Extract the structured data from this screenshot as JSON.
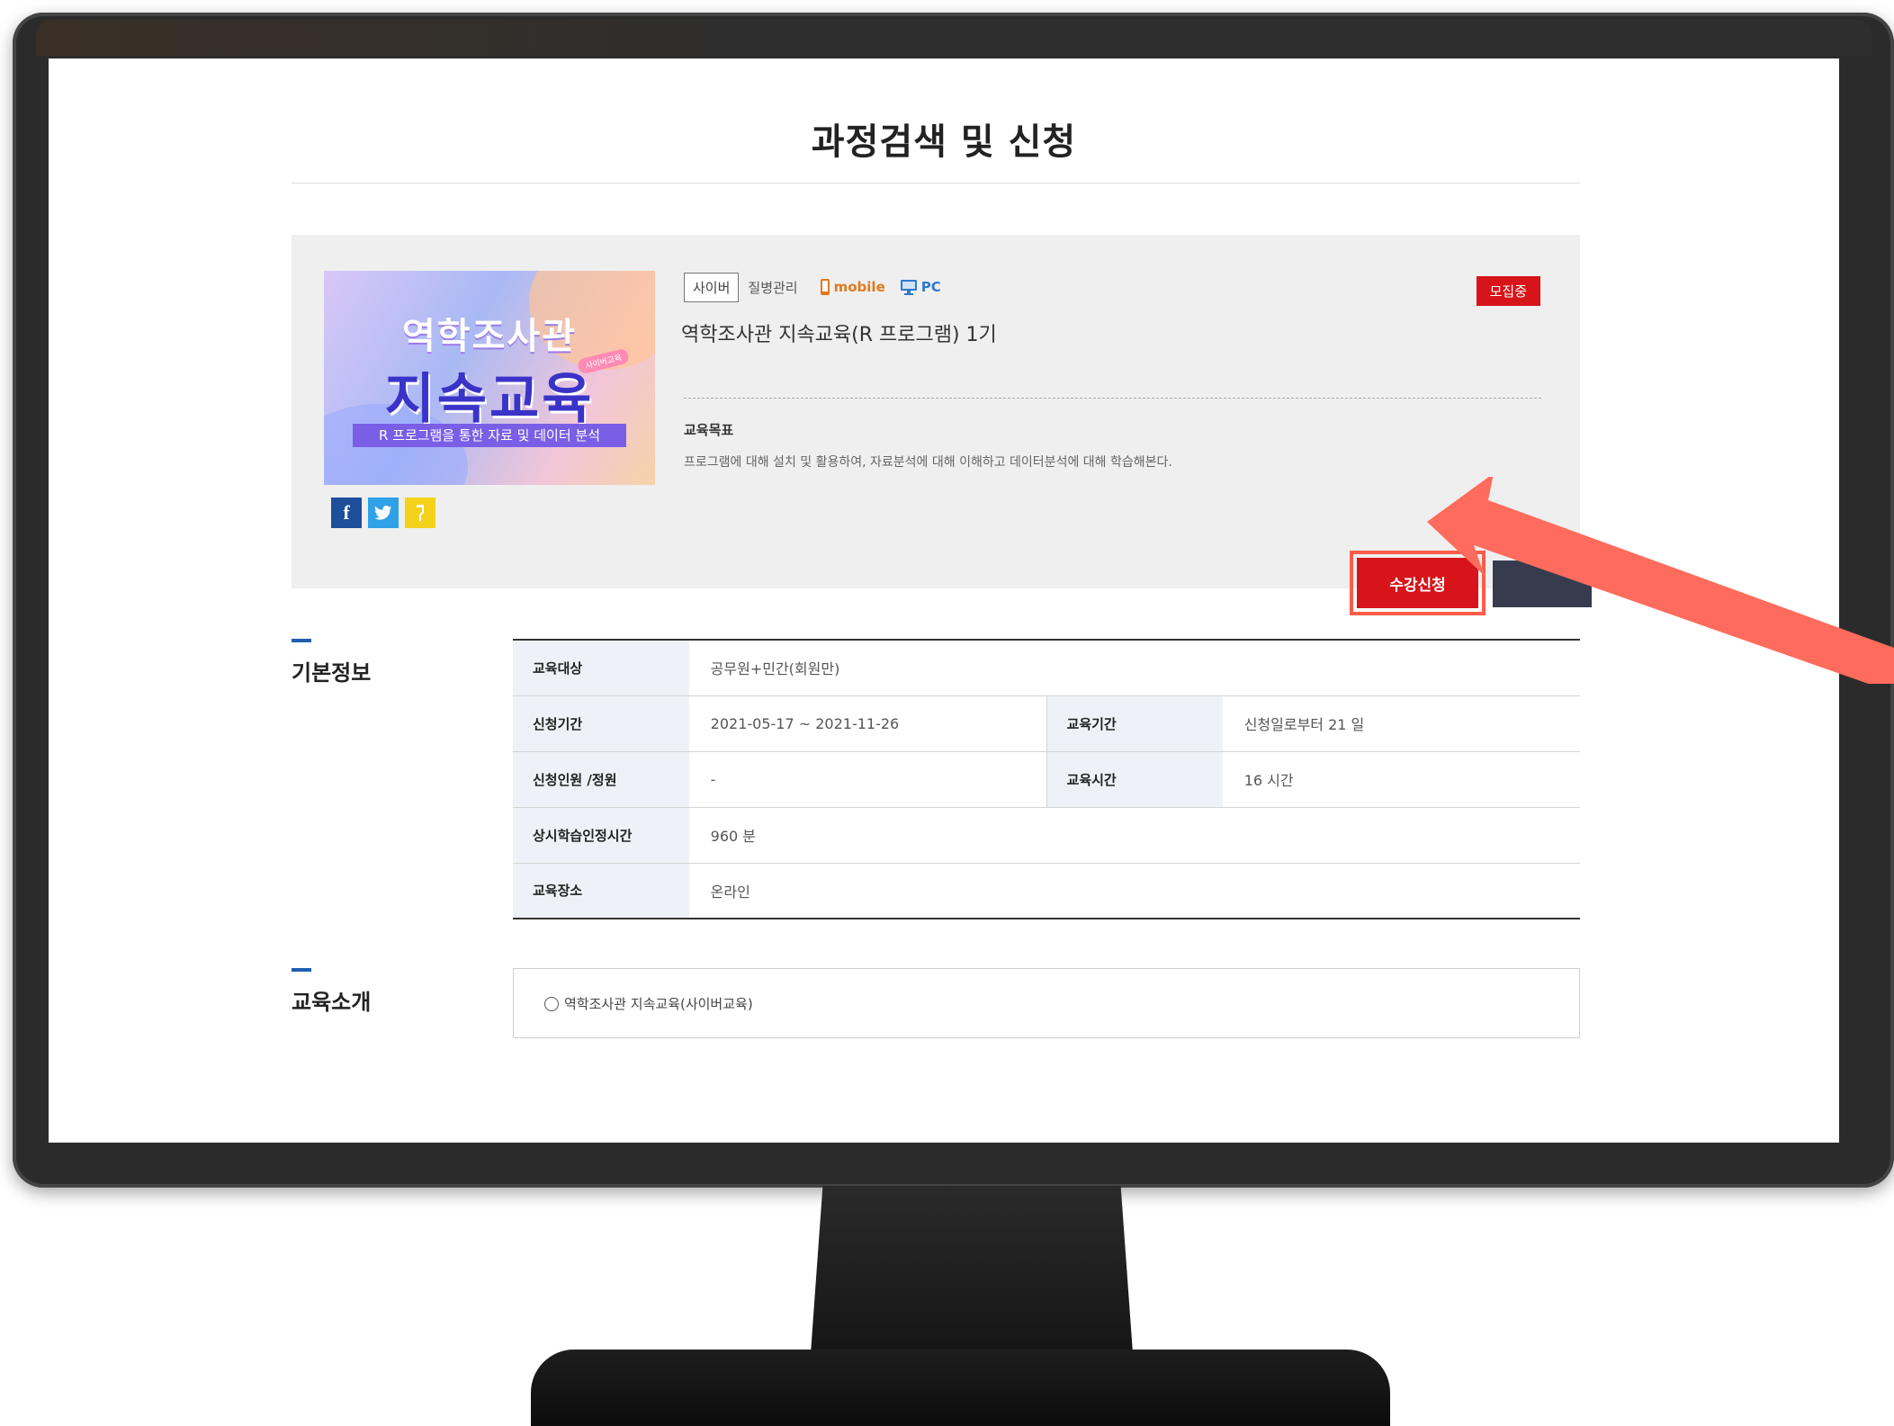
{
  "page": {
    "title": "과정검색 및 신청"
  },
  "course": {
    "thumbnail": {
      "line1": "역학조사관",
      "line2": "지속교육",
      "badge": "사이버교육",
      "strip": "R 프로그램을 통한 자료 및 데이터 분석"
    },
    "tag_type": "사이버",
    "category": "질병관리",
    "device_mobile": "mobile",
    "device_pc": "PC",
    "status": "모집중",
    "name": "역학조사관 지속교육(R 프로그램) 1기",
    "goal_label": "교육목표",
    "goal_text": "프로그램에 대해 설치 및 활용하여, 자료분석에 대해 이해하고 데이터분석에 대해 학습해본다.",
    "apply_label": "수강신청",
    "share_icons": [
      "facebook-icon",
      "twitter-icon",
      "kakaostory-icon"
    ]
  },
  "basic_info": {
    "heading": "기본정보",
    "rows": {
      "target_label": "교육대상",
      "target_value": "공무원+민간(회원만)",
      "apply_period_label": "신청기간",
      "apply_period_value": "2021-05-17 ~ 2021-11-26",
      "edu_period_label": "교육기간",
      "edu_period_value": "신청일로부터 21 일",
      "count_label": "신청인원 /정원",
      "count_value": "-",
      "edu_time_label": "교육시간",
      "edu_time_value": "16 시간",
      "recog_label": "상시학습인정시간",
      "recog_value": "960 분",
      "place_label": "교육장소",
      "place_value": "온라인"
    }
  },
  "intro": {
    "heading": "교육소개",
    "text": "역학조사관 지속교육(사이버교육)"
  },
  "colors": {
    "accent_red": "#d7141a",
    "annotation": "#ff6b5c",
    "section_blue": "#1f5fb0",
    "dark_button": "#363b4d"
  }
}
